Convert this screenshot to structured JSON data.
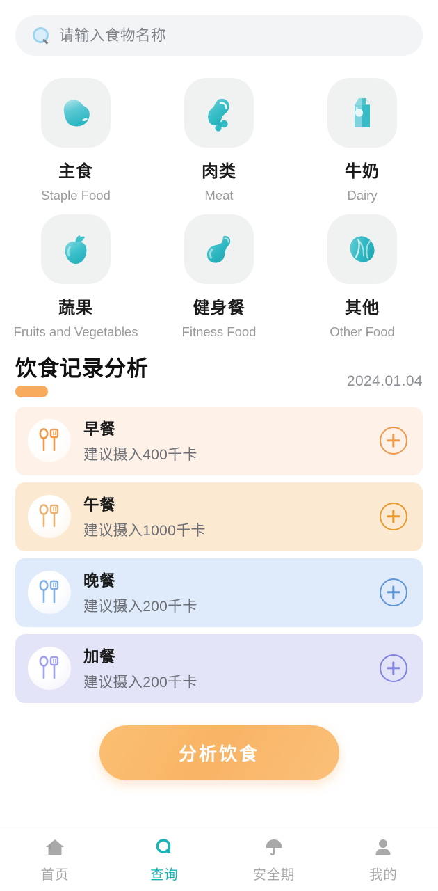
{
  "search": {
    "placeholder": "请输入食物名称",
    "value": "",
    "icon": "search-icon"
  },
  "categories": [
    {
      "zh": "主食",
      "en": "Staple Food",
      "icon": "rice-bowl-icon",
      "color": "#3ec2cc"
    },
    {
      "zh": "肉类",
      "en": "Meat",
      "icon": "drumstick-icon",
      "color": "#30bcc6"
    },
    {
      "zh": "牛奶",
      "en": "Dairy",
      "icon": "milk-carton-icon",
      "color": "#46c3cd"
    },
    {
      "zh": "蔬果",
      "en": "Fruits and Vegetables",
      "icon": "apple-icon",
      "color": "#35c0ca"
    },
    {
      "zh": "健身餐",
      "en": "Fitness Food",
      "icon": "bicep-icon",
      "color": "#2db8c2"
    },
    {
      "zh": "其他",
      "en": "Other Food",
      "icon": "coffee-bean-icon",
      "color": "#31bcc6"
    }
  ],
  "analysis": {
    "title": "饮食记录分析",
    "date": "2024.01.04",
    "underline_color": "#f8ab5c"
  },
  "meals": [
    {
      "name": "早餐",
      "sub": "建议摄入400千卡",
      "bg": "#fdf1e8",
      "accent": "#ef9a4b",
      "plus_color": "#ef9a4b",
      "icon": "spoon-fork-icon"
    },
    {
      "name": "午餐",
      "sub": "建议摄入1000千卡",
      "bg": "#fce9d2",
      "accent": "#e9a24f",
      "plus_color": "#e9992f",
      "icon": "spoon-fork-icon"
    },
    {
      "name": "晚餐",
      "sub": "建议摄入200千卡",
      "bg": "#dfeafb",
      "accent": "#6fa8e6",
      "plus_color": "#5f96d8",
      "icon": "spoon-fork-icon"
    },
    {
      "name": "加餐",
      "sub": "建议摄入200千卡",
      "bg": "#e3e4f8",
      "accent": "#8e90e8",
      "plus_color": "#8183e2",
      "icon": "spoon-fork-icon"
    }
  ],
  "analyze_button": {
    "label": "分析饮食",
    "color": "#f9b465"
  },
  "bottom_nav": {
    "active_color": "#18b3b7",
    "inactive_color": "#a7a7a7",
    "items": [
      {
        "label": "首页",
        "icon": "home-icon",
        "active": false
      },
      {
        "label": "查询",
        "icon": "search-ring-icon",
        "active": true
      },
      {
        "label": "安全期",
        "icon": "umbrella-icon",
        "active": false
      },
      {
        "label": "我的",
        "icon": "person-icon",
        "active": false
      }
    ]
  }
}
